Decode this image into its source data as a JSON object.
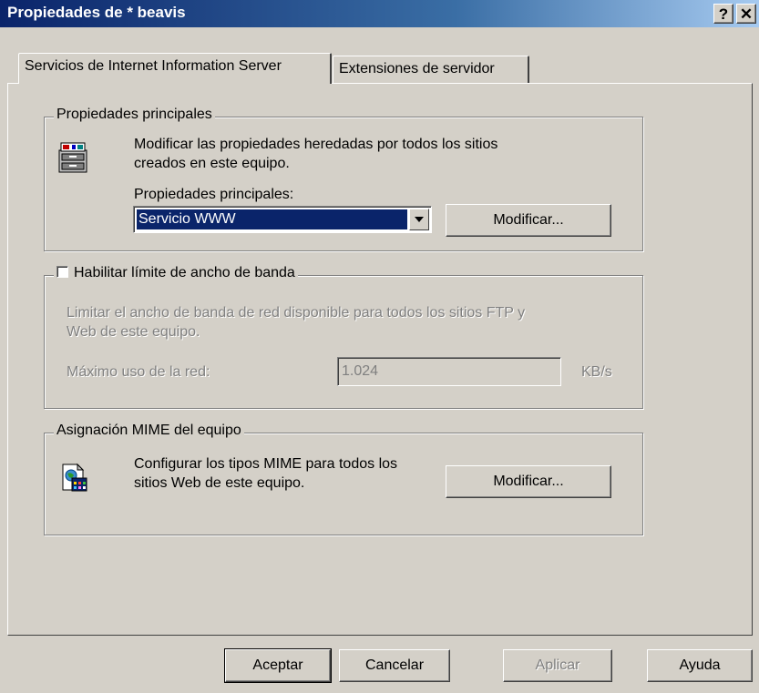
{
  "window": {
    "title": "Propiedades de * beavis",
    "help_button": "?",
    "close_button": "✕"
  },
  "tabs": [
    {
      "label": "Servicios de Internet Information Server",
      "active": true
    },
    {
      "label": "Extensiones de servidor",
      "active": false
    }
  ],
  "master_properties": {
    "legend": "Propiedades principales",
    "icon": "server-properties-icon",
    "description_line1": "Modificar las propiedades heredadas por todos los sitios",
    "description_line2": "creados en este equipo.",
    "select_label": "Propiedades principales:",
    "select_value": "Servicio WWW",
    "edit_button": "Modificar..."
  },
  "bandwidth": {
    "checkbox_label": "Habilitar límite de ancho de banda",
    "checked": false,
    "description_line1": "Limitar el ancho de banda de red disponible para todos los sitios FTP y",
    "description_line2": "Web de este equipo.",
    "max_label": "Máximo uso de la red:",
    "max_value": "1.024",
    "unit": "KB/s"
  },
  "mime": {
    "legend": "Asignación MIME del equipo",
    "icon": "mime-types-icon",
    "description_line1": "Configurar los tipos MIME para todos los",
    "description_line2": "sitios Web de este equipo.",
    "edit_button": "Modificar..."
  },
  "footer": {
    "ok": "Aceptar",
    "cancel": "Cancelar",
    "apply": "Aplicar",
    "help": "Ayuda"
  }
}
